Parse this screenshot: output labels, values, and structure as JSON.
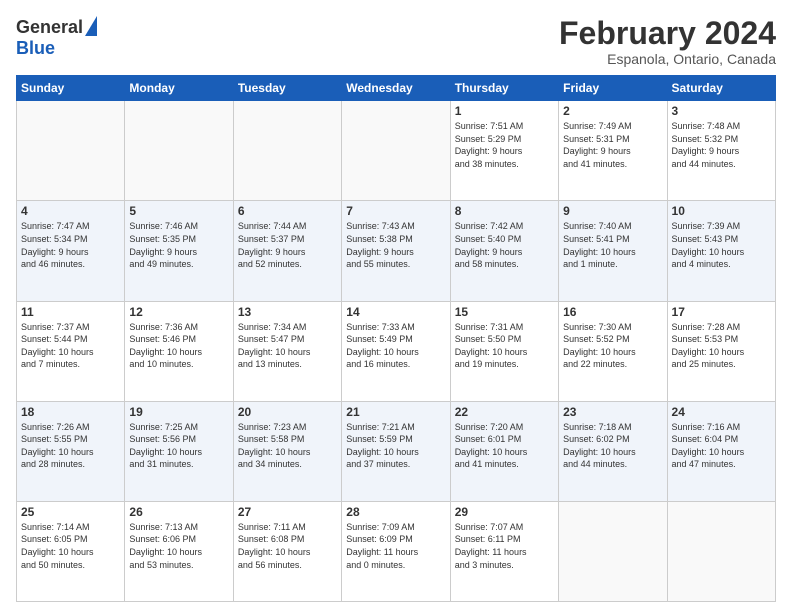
{
  "header": {
    "logo_general": "General",
    "logo_blue": "Blue",
    "month_title": "February 2024",
    "location": "Espanola, Ontario, Canada"
  },
  "calendar": {
    "days_of_week": [
      "Sunday",
      "Monday",
      "Tuesday",
      "Wednesday",
      "Thursday",
      "Friday",
      "Saturday"
    ],
    "weeks": [
      [
        {
          "day": "",
          "info": ""
        },
        {
          "day": "",
          "info": ""
        },
        {
          "day": "",
          "info": ""
        },
        {
          "day": "",
          "info": ""
        },
        {
          "day": "1",
          "info": "Sunrise: 7:51 AM\nSunset: 5:29 PM\nDaylight: 9 hours\nand 38 minutes."
        },
        {
          "day": "2",
          "info": "Sunrise: 7:49 AM\nSunset: 5:31 PM\nDaylight: 9 hours\nand 41 minutes."
        },
        {
          "day": "3",
          "info": "Sunrise: 7:48 AM\nSunset: 5:32 PM\nDaylight: 9 hours\nand 44 minutes."
        }
      ],
      [
        {
          "day": "4",
          "info": "Sunrise: 7:47 AM\nSunset: 5:34 PM\nDaylight: 9 hours\nand 46 minutes."
        },
        {
          "day": "5",
          "info": "Sunrise: 7:46 AM\nSunset: 5:35 PM\nDaylight: 9 hours\nand 49 minutes."
        },
        {
          "day": "6",
          "info": "Sunrise: 7:44 AM\nSunset: 5:37 PM\nDaylight: 9 hours\nand 52 minutes."
        },
        {
          "day": "7",
          "info": "Sunrise: 7:43 AM\nSunset: 5:38 PM\nDaylight: 9 hours\nand 55 minutes."
        },
        {
          "day": "8",
          "info": "Sunrise: 7:42 AM\nSunset: 5:40 PM\nDaylight: 9 hours\nand 58 minutes."
        },
        {
          "day": "9",
          "info": "Sunrise: 7:40 AM\nSunset: 5:41 PM\nDaylight: 10 hours\nand 1 minute."
        },
        {
          "day": "10",
          "info": "Sunrise: 7:39 AM\nSunset: 5:43 PM\nDaylight: 10 hours\nand 4 minutes."
        }
      ],
      [
        {
          "day": "11",
          "info": "Sunrise: 7:37 AM\nSunset: 5:44 PM\nDaylight: 10 hours\nand 7 minutes."
        },
        {
          "day": "12",
          "info": "Sunrise: 7:36 AM\nSunset: 5:46 PM\nDaylight: 10 hours\nand 10 minutes."
        },
        {
          "day": "13",
          "info": "Sunrise: 7:34 AM\nSunset: 5:47 PM\nDaylight: 10 hours\nand 13 minutes."
        },
        {
          "day": "14",
          "info": "Sunrise: 7:33 AM\nSunset: 5:49 PM\nDaylight: 10 hours\nand 16 minutes."
        },
        {
          "day": "15",
          "info": "Sunrise: 7:31 AM\nSunset: 5:50 PM\nDaylight: 10 hours\nand 19 minutes."
        },
        {
          "day": "16",
          "info": "Sunrise: 7:30 AM\nSunset: 5:52 PM\nDaylight: 10 hours\nand 22 minutes."
        },
        {
          "day": "17",
          "info": "Sunrise: 7:28 AM\nSunset: 5:53 PM\nDaylight: 10 hours\nand 25 minutes."
        }
      ],
      [
        {
          "day": "18",
          "info": "Sunrise: 7:26 AM\nSunset: 5:55 PM\nDaylight: 10 hours\nand 28 minutes."
        },
        {
          "day": "19",
          "info": "Sunrise: 7:25 AM\nSunset: 5:56 PM\nDaylight: 10 hours\nand 31 minutes."
        },
        {
          "day": "20",
          "info": "Sunrise: 7:23 AM\nSunset: 5:58 PM\nDaylight: 10 hours\nand 34 minutes."
        },
        {
          "day": "21",
          "info": "Sunrise: 7:21 AM\nSunset: 5:59 PM\nDaylight: 10 hours\nand 37 minutes."
        },
        {
          "day": "22",
          "info": "Sunrise: 7:20 AM\nSunset: 6:01 PM\nDaylight: 10 hours\nand 41 minutes."
        },
        {
          "day": "23",
          "info": "Sunrise: 7:18 AM\nSunset: 6:02 PM\nDaylight: 10 hours\nand 44 minutes."
        },
        {
          "day": "24",
          "info": "Sunrise: 7:16 AM\nSunset: 6:04 PM\nDaylight: 10 hours\nand 47 minutes."
        }
      ],
      [
        {
          "day": "25",
          "info": "Sunrise: 7:14 AM\nSunset: 6:05 PM\nDaylight: 10 hours\nand 50 minutes."
        },
        {
          "day": "26",
          "info": "Sunrise: 7:13 AM\nSunset: 6:06 PM\nDaylight: 10 hours\nand 53 minutes."
        },
        {
          "day": "27",
          "info": "Sunrise: 7:11 AM\nSunset: 6:08 PM\nDaylight: 10 hours\nand 56 minutes."
        },
        {
          "day": "28",
          "info": "Sunrise: 7:09 AM\nSunset: 6:09 PM\nDaylight: 11 hours\nand 0 minutes."
        },
        {
          "day": "29",
          "info": "Sunrise: 7:07 AM\nSunset: 6:11 PM\nDaylight: 11 hours\nand 3 minutes."
        },
        {
          "day": "",
          "info": ""
        },
        {
          "day": "",
          "info": ""
        }
      ]
    ]
  }
}
